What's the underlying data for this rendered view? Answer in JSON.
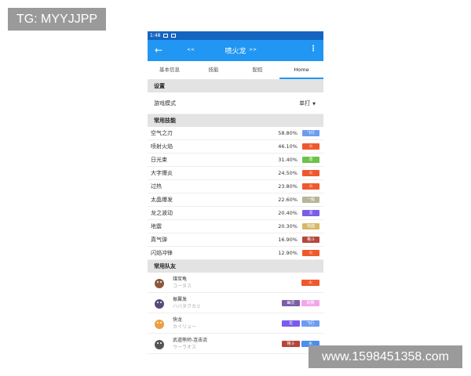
{
  "watermarks": {
    "top_left": "TG: MYYJJPP",
    "bottom_right": "www.1598451358.com"
  },
  "status": {
    "time": "1:48"
  },
  "appbar": {
    "back_icon": "arrow-left-icon",
    "prev": "<<",
    "title": "喷火龙",
    "next": ">>",
    "more_icon": "more-vert-icon"
  },
  "tabs": [
    {
      "label": "基本信息",
      "active": false
    },
    {
      "label": "技能",
      "active": false
    },
    {
      "label": "配招",
      "active": false
    },
    {
      "label": "Home",
      "active": true
    }
  ],
  "settings": {
    "header": "设置",
    "game_mode_label": "游戏模式",
    "game_mode_value": "单打"
  },
  "moves": {
    "header": "常用技能",
    "items": [
      {
        "name": "空气之刃",
        "pct": "58.80%",
        "type": "飞行",
        "color": "#6f9cf2"
      },
      {
        "name": "喷射火焰",
        "pct": "46.10%",
        "type": "火",
        "color": "#f0582c"
      },
      {
        "name": "日光束",
        "pct": "31.40%",
        "type": "草",
        "color": "#6cc24a"
      },
      {
        "name": "大字爆炎",
        "pct": "24.50%",
        "type": "火",
        "color": "#f0582c"
      },
      {
        "name": "过热",
        "pct": "23.80%",
        "type": "火",
        "color": "#f0582c"
      },
      {
        "name": "太晶爆发",
        "pct": "22.60%",
        "type": "一般",
        "color": "#b5b59a"
      },
      {
        "name": "龙之波动",
        "pct": "20.40%",
        "type": "龙",
        "color": "#7a5cec"
      },
      {
        "name": "地震",
        "pct": "20.30%",
        "type": "地面",
        "color": "#d8b867"
      },
      {
        "name": "真气弹",
        "pct": "16.90%",
        "type": "格斗",
        "color": "#b5473a"
      },
      {
        "name": "闪焰冲锋",
        "pct": "12.90%",
        "type": "火",
        "color": "#f0582c"
      }
    ]
  },
  "mates": {
    "header": "常用队友",
    "items": [
      {
        "cn": "煤炭龟",
        "jp": "コータス",
        "types": [
          {
            "label": "火",
            "color": "#f0582c"
          }
        ],
        "sprite_color": "#8a5a3a"
      },
      {
        "cn": "振翼发",
        "jp": "ハバタクカミ",
        "types": [
          {
            "label": "幽灵",
            "color": "#7a5fa8"
          },
          {
            "label": "妖精",
            "color": "#f2a6e8"
          }
        ],
        "sprite_color": "#5a4a7a"
      },
      {
        "cn": "快龙",
        "jp": "カイリュー",
        "types": [
          {
            "label": "龙",
            "color": "#7a5cec"
          },
          {
            "label": "飞行",
            "color": "#6f9cf2"
          }
        ],
        "sprite_color": "#e8a040"
      },
      {
        "cn": "武道熊师-连击流",
        "jp": "ウーラオス",
        "types": [
          {
            "label": "格斗",
            "color": "#b5473a"
          },
          {
            "label": "水",
            "color": "#4a8ef0"
          }
        ],
        "sprite_color": "#555555"
      }
    ]
  }
}
